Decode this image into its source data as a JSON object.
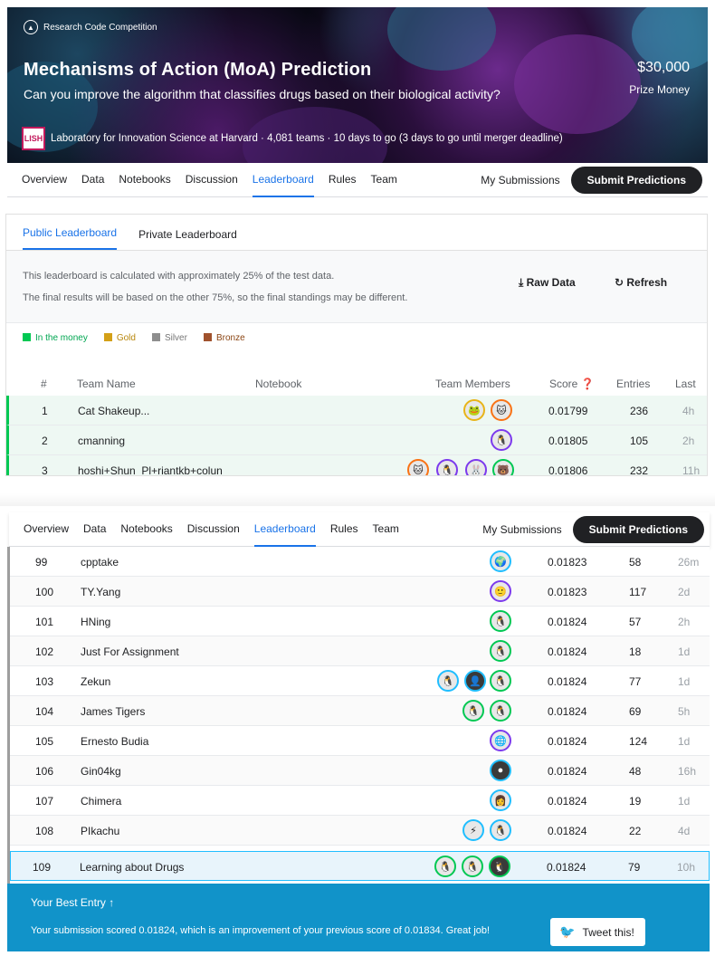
{
  "banner": {
    "comp_type": "Research Code Competition",
    "title": "Mechanisms of Action (MoA) Prediction",
    "subtitle": "Can you improve the algorithm that classifies drugs based on their biological activity?",
    "prize": "$30,000",
    "prize_label": "Prize Money",
    "host_logo_text": "LISH",
    "host_line": "Laboratory for Innovation Science at Harvard · 4,081 teams · 10 days to go (3 days to go until merger deadline)"
  },
  "nav": {
    "tabs": [
      "Overview",
      "Data",
      "Notebooks",
      "Discussion",
      "Leaderboard",
      "Rules",
      "Team"
    ],
    "active": "Leaderboard",
    "my_submissions": "My Submissions",
    "submit": "Submit Predictions"
  },
  "leaderboard": {
    "tabs": [
      "Public Leaderboard",
      "Private Leaderboard"
    ],
    "notice_line1": "This leaderboard is calculated with approximately 25% of the test data.",
    "notice_line2": "The final results will be based on the other 75%, so the final standings may be different.",
    "raw_data": "Raw Data",
    "refresh": "Refresh",
    "legend": [
      {
        "label": "In the money",
        "color": "#00c853"
      },
      {
        "label": "Gold",
        "color": "#d4a017"
      },
      {
        "label": "Silver",
        "color": "#8e8e8e"
      },
      {
        "label": "Bronze",
        "color": "#a0522d"
      }
    ],
    "headers": {
      "rank": "#",
      "team": "Team Name",
      "notebook": "Notebook",
      "members": "Team Members",
      "score": "Score",
      "entries": "Entries",
      "last": "Last"
    },
    "top_rows": [
      {
        "rank": "1",
        "team": "Cat Shakeup...",
        "score": "0.01799",
        "entries": "236",
        "last": "4h"
      },
      {
        "rank": "2",
        "team": "cmanning",
        "score": "0.01805",
        "entries": "105",
        "last": "2h"
      },
      {
        "rank": "3",
        "team": "hoshi+Shun_Pl+riantkb+colun",
        "score": "0.01806",
        "entries": "232",
        "last": "11h"
      }
    ],
    "rows": [
      {
        "rank": "99",
        "team": "cpptake",
        "score": "0.01823",
        "entries": "58",
        "last": "26m"
      },
      {
        "rank": "100",
        "team": "TY.Yang",
        "score": "0.01823",
        "entries": "117",
        "last": "2d"
      },
      {
        "rank": "101",
        "team": "HNing",
        "score": "0.01824",
        "entries": "57",
        "last": "2h"
      },
      {
        "rank": "102",
        "team": "Just For Assignment",
        "score": "0.01824",
        "entries": "18",
        "last": "1d"
      },
      {
        "rank": "103",
        "team": "Zekun",
        "score": "0.01824",
        "entries": "77",
        "last": "1d"
      },
      {
        "rank": "104",
        "team": "James Tigers",
        "score": "0.01824",
        "entries": "69",
        "last": "5h"
      },
      {
        "rank": "105",
        "team": "Ernesto Budia",
        "score": "0.01824",
        "entries": "124",
        "last": "1d"
      },
      {
        "rank": "106",
        "team": "Gin04kg",
        "score": "0.01824",
        "entries": "48",
        "last": "16h"
      },
      {
        "rank": "107",
        "team": "Chimera",
        "score": "0.01824",
        "entries": "19",
        "last": "1d"
      },
      {
        "rank": "108",
        "team": "PIkachu",
        "score": "0.01824",
        "entries": "22",
        "last": "4d"
      },
      {
        "rank": "109",
        "team": "Learning about Drugs",
        "score": "0.01824",
        "entries": "79",
        "last": "10h"
      }
    ],
    "best_entry": {
      "heading": "Your Best Entry ↑",
      "message": "Your submission scored 0.01824, which is an improvement of your previous score of 0.01834. Great job!",
      "tweet": "Tweet this!"
    }
  }
}
